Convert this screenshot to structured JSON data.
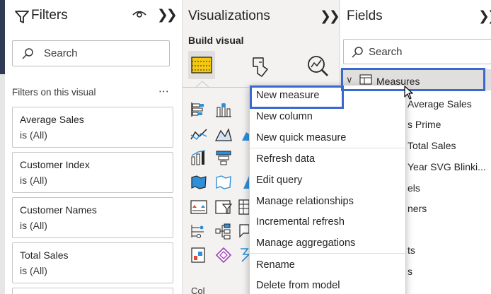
{
  "filters": {
    "title": "Filters",
    "search_placeholder": "Search",
    "section_label": "Filters on this visual",
    "cards": [
      {
        "name": "Average Sales",
        "value": "is (All)"
      },
      {
        "name": "Customer Index",
        "value": "is (All)"
      },
      {
        "name": "Customer Names",
        "value": "is (All)"
      },
      {
        "name": "Total Sales",
        "value": "is (All)"
      }
    ]
  },
  "visualizations": {
    "title": "Visualizations",
    "build_visual_label": "Build visual",
    "bottom_label": "Col"
  },
  "fields": {
    "title": "Fields",
    "search_placeholder": "Search",
    "measures_label": "Measures",
    "items": [
      "Average Sales",
      "s Prime",
      "Total Sales",
      "Year SVG Blinki...",
      "els",
      "ners",
      "ts",
      "s"
    ]
  },
  "context_menu": {
    "items": [
      "New measure",
      "New column",
      "New quick measure",
      "Refresh data",
      "Edit query",
      "Manage relationships",
      "Incremental refresh",
      "Manage aggregations",
      "Rename",
      "Delete from model"
    ]
  },
  "colors": {
    "highlight": "#3a6ad0",
    "accent_yellow": "#f2c811",
    "sidebar_dark": "#2f3b55"
  }
}
